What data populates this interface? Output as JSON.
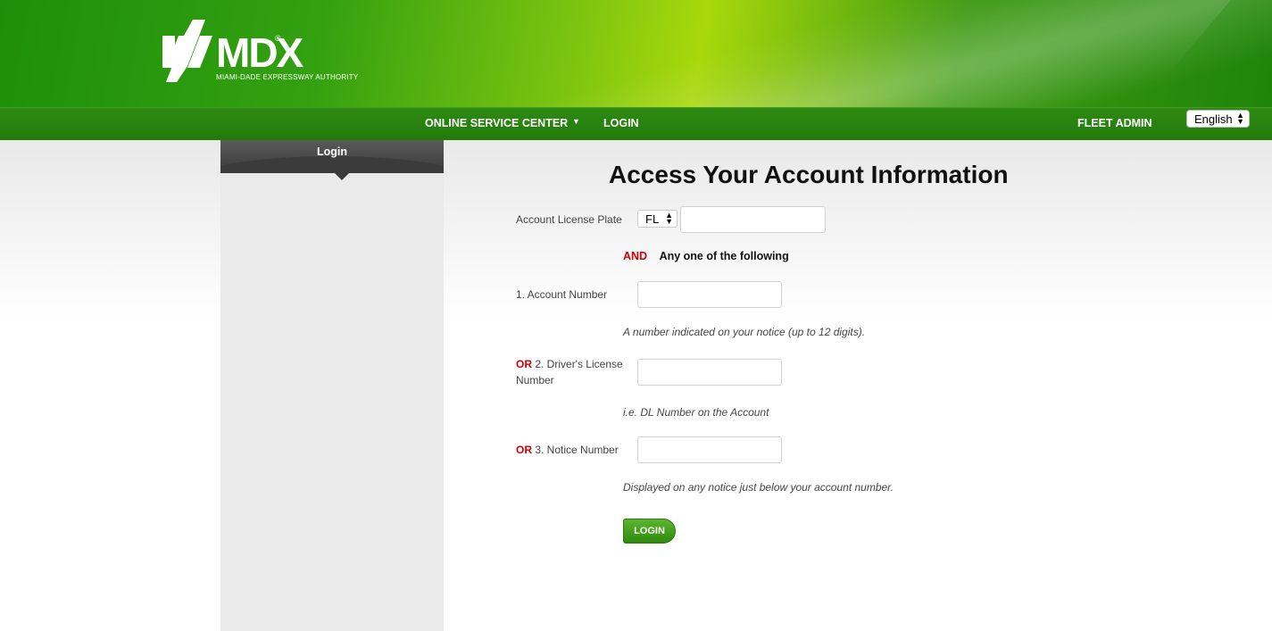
{
  "header": {
    "logo_word": "MDX",
    "logo_reg": "®",
    "logo_subtitle": "MIAMI-DADE EXPRESSWAY AUTHORITY"
  },
  "nav": {
    "online_service_center": "ONLINE SERVICE CENTER",
    "login": "LOGIN",
    "fleet_admin": "FLEET ADMIN",
    "language": "English"
  },
  "sidebar": {
    "title": "Login"
  },
  "form": {
    "title": "Access Your Account Information",
    "license_plate_label": "Account License Plate",
    "state_value": "FL",
    "and_text": "AND",
    "any_one_text": "Any one of the following",
    "account_number_label": "1. Account Number",
    "account_number_hint": "A number indicated on your notice (up to 12 digits).",
    "or_text": "OR",
    "drivers_license_label": "2. Driver's License Number",
    "drivers_license_hint": "i.e. DL Number on the Account",
    "notice_number_label": "3. Notice Number",
    "notice_number_hint": "Displayed on any notice just below your account number.",
    "login_button": "LOGIN"
  },
  "colors": {
    "brand_green": "#237a0b",
    "accent_red": "#d10000"
  },
  "icons": {
    "nav_dropdown": "caret-down-icon",
    "select_arrows": "up-down-arrows-icon"
  }
}
